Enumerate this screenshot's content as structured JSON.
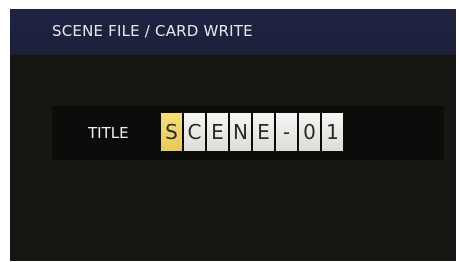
{
  "header": {
    "title": "SCENE FILE / CARD WRITE"
  },
  "title_field": {
    "label": "TITLE",
    "characters": [
      "S",
      "C",
      "E",
      "N",
      "E",
      "-",
      "0",
      "1"
    ],
    "selected_index": 0
  },
  "colors": {
    "header_bg": "#1e2240",
    "screen_bg": "#141612",
    "cell_bg": "#e8e8e6",
    "cell_selected_bg": "#f0d46a"
  }
}
